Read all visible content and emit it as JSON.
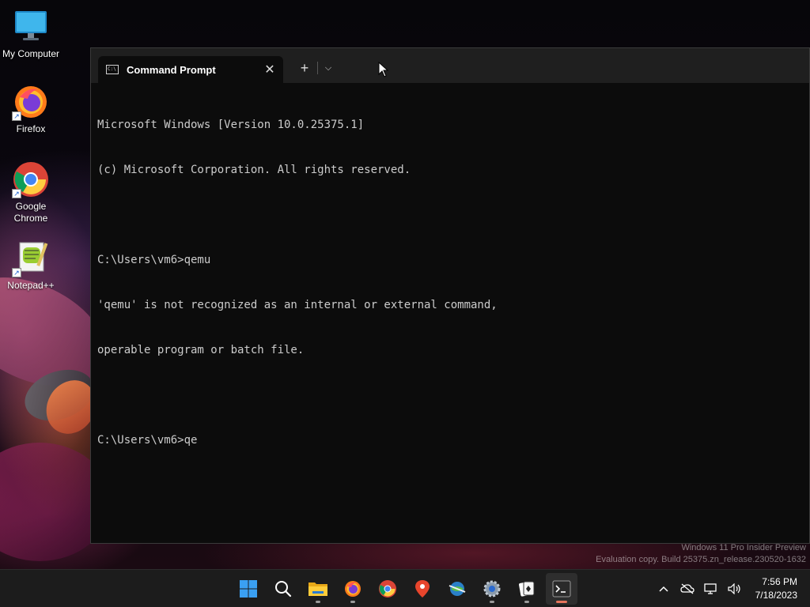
{
  "desktop": {
    "icons": [
      {
        "label": "My Computer",
        "icon": "monitor-icon"
      },
      {
        "label": "Firefox",
        "icon": "firefox-icon"
      },
      {
        "label": "Google Chrome",
        "icon": "chrome-icon"
      },
      {
        "label": "Notepad++",
        "icon": "notepadpp-icon"
      }
    ]
  },
  "terminal": {
    "tab_title": "Command Prompt",
    "tab_icon_text": "C:\\",
    "close_glyph": "✕",
    "new_tab_glyph": "+",
    "dropdown_glyph": "⌵",
    "lines": [
      "Microsoft Windows [Version 10.0.25375.1]",
      "(c) Microsoft Corporation. All rights reserved.",
      "",
      "C:\\Users\\vm6>qemu",
      "'qemu' is not recognized as an internal or external command,",
      "operable program or batch file.",
      "",
      "C:\\Users\\vm6>qe"
    ]
  },
  "watermark": {
    "line1": "Windows 11 Pro Insider Preview",
    "line2": "Evaluation copy. Build 25375.zn_release.230520-1632"
  },
  "taskbar": {
    "items": [
      {
        "name": "start",
        "icon": "windows-logo-icon"
      },
      {
        "name": "search",
        "icon": "search-icon"
      },
      {
        "name": "file-explorer",
        "icon": "folder-icon"
      },
      {
        "name": "firefox",
        "icon": "firefox-icon"
      },
      {
        "name": "chrome",
        "icon": "chrome-icon"
      },
      {
        "name": "maps",
        "icon": "map-pin-icon"
      },
      {
        "name": "idm",
        "icon": "download-globe-icon"
      },
      {
        "name": "settings",
        "icon": "gear-icon"
      },
      {
        "name": "solitaire",
        "icon": "cards-icon"
      },
      {
        "name": "terminal",
        "icon": "terminal-icon"
      }
    ],
    "tray": {
      "chevron_glyph": "^",
      "network_icon": "network-icon",
      "volume_icon": "speaker-icon"
    },
    "clock": {
      "time": "7:56 PM",
      "date": "7/18/2023"
    }
  },
  "colors": {
    "terminal_bg": "#0c0c0c",
    "terminal_fg": "#cccccc",
    "titlebar_bg": "#1f1f1f",
    "taskbar_bg": "#1c1c1c",
    "accent": "#e6745c"
  }
}
